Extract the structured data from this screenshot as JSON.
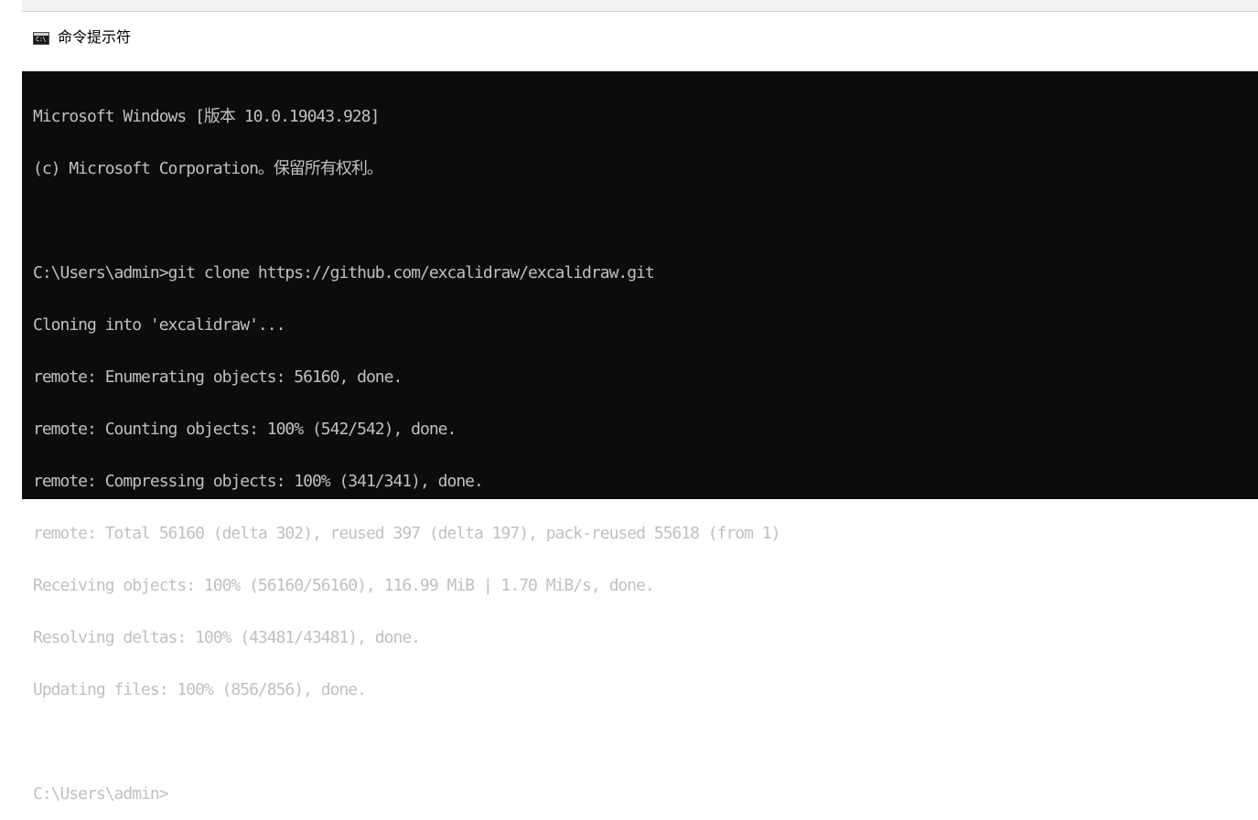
{
  "window": {
    "title": "命令提示符",
    "icon": "cmd-icon",
    "icon_glyph": "C:\\"
  },
  "console": {
    "lines": [
      "Microsoft Windows [版本 10.0.19043.928]",
      "(c) Microsoft Corporation。保留所有权利。",
      "",
      "C:\\Users\\admin>git clone https://github.com/excalidraw/excalidraw.git",
      "Cloning into 'excalidraw'...",
      "remote: Enumerating objects: 56160, done.",
      "remote: Counting objects: 100% (542/542), done.",
      "remote: Compressing objects: 100% (341/341), done.",
      "remote: Total 56160 (delta 302), reused 397 (delta 197), pack-reused 55618 (from 1)",
      "Receiving objects: 100% (56160/56160), 116.99 MiB | 1.70 MiB/s, done.",
      "Resolving deltas: 100% (43481/43481), done.",
      "Updating files: 100% (856/856), done.",
      "",
      "C:\\Users\\admin>"
    ]
  },
  "colors": {
    "console_bg": "#0c0c0c",
    "console_fg": "#c0c0c0",
    "titlebar_bg": "#ffffff"
  }
}
